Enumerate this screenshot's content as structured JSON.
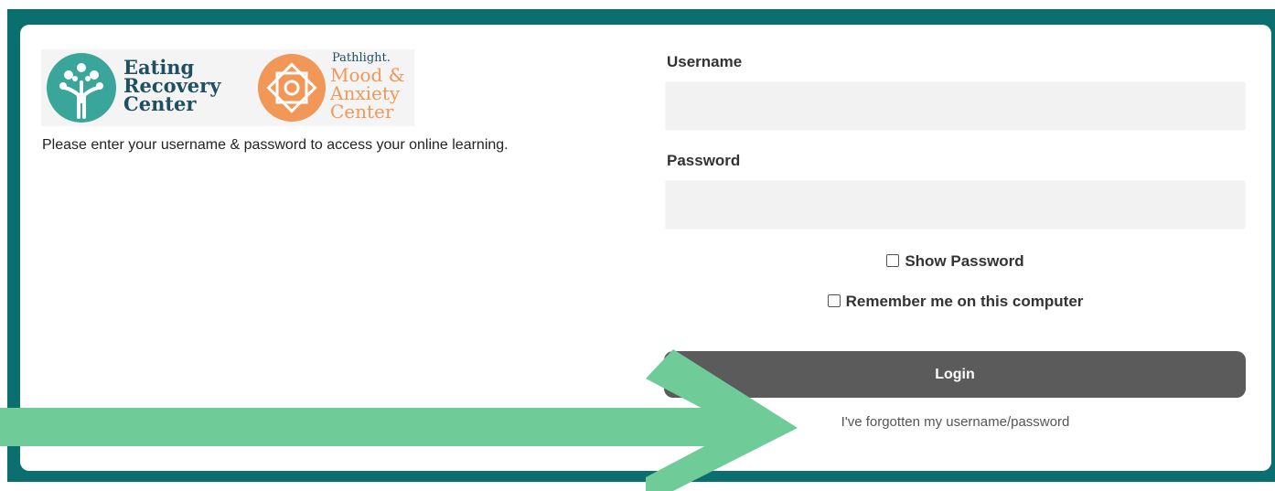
{
  "logos": {
    "erc": {
      "lines": [
        "Eating",
        "Recovery",
        "Center"
      ],
      "color": "#1f4f60",
      "icon": "tree-icon",
      "icon_color": "#3aa59a"
    },
    "pml": {
      "brand": "Pathlight.",
      "lines": [
        "Mood &",
        "Anxiety",
        "Center"
      ],
      "color": "#f19758",
      "icon": "mandala-icon"
    }
  },
  "intro_text": "Please enter your username & password to access your online learning.",
  "form": {
    "username_label": "Username",
    "username_value": "",
    "password_label": "Password",
    "password_value": "",
    "show_password_label": "Show Password",
    "remember_label": "Remember me on this computer",
    "login_label": "Login",
    "forgot_link": "I've forgotten my username/password"
  },
  "colors": {
    "frame": "#0b6f70",
    "button": "#5b5b5b",
    "arrow": "#6fcb98"
  },
  "overlay": {
    "arrow": "arrow-icon"
  }
}
